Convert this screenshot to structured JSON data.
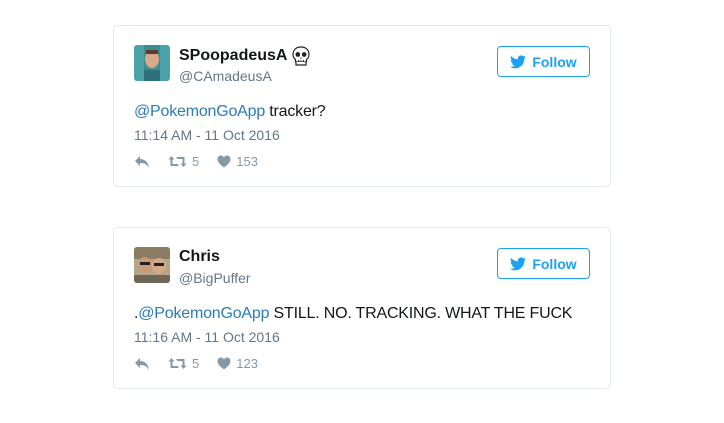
{
  "tweets": [
    {
      "display_name": "SPoopadeusA",
      "emoji_icon": "skull-icon",
      "handle": "@CAmadeusA",
      "follow_label": "Follow",
      "text_prefix": "",
      "mention": "@PokemonGoApp",
      "text_rest": " tracker?",
      "timestamp": "11:14 AM - 11 Oct 2016",
      "retweets": "5",
      "likes": "153"
    },
    {
      "display_name": "Chris",
      "emoji_icon": "",
      "handle": "@BigPuffer",
      "follow_label": "Follow",
      "text_prefix": ".",
      "mention": "@PokemonGoApp",
      "text_rest": " STILL. NO. TRACKING. WHAT THE FUCK",
      "timestamp": "11:16 AM - 11 Oct 2016",
      "retweets": "5",
      "likes": "123"
    }
  ],
  "colors": {
    "brand_blue": "#1da1f2",
    "link_blue": "#2b7bb9",
    "muted_text": "#657786",
    "icon_gray": "#8899a6",
    "border": "#e1e8ed"
  }
}
